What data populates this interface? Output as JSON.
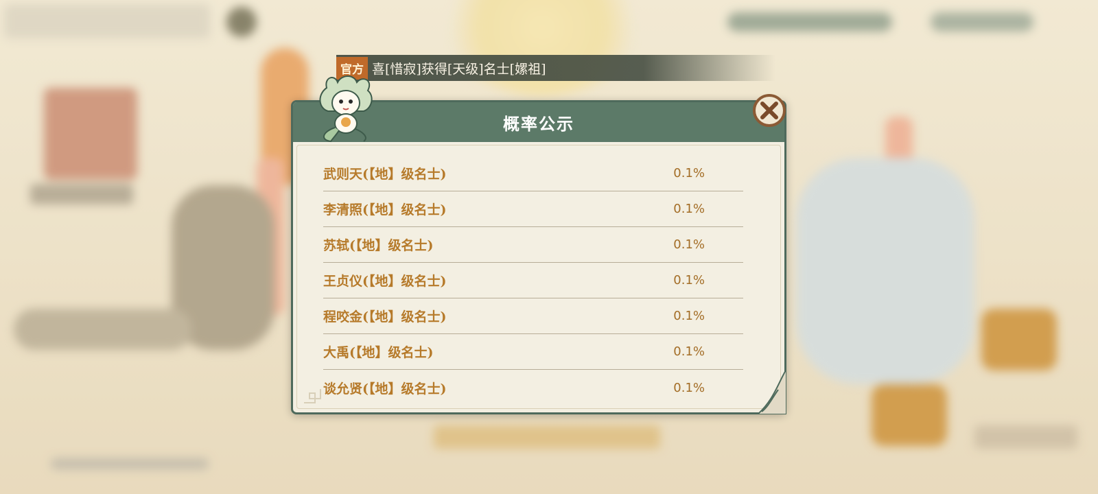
{
  "broadcast": {
    "tag": "官方",
    "message": "喜[惜寂]获得[天级]名士[嫘祖]"
  },
  "dialog": {
    "title": "概率公示",
    "close_icon": "close-x-icon",
    "rows": [
      {
        "name": "武则天(【地】级名士)",
        "rate": "0.1%"
      },
      {
        "name": "李清照(【地】级名士)",
        "rate": "0.1%"
      },
      {
        "name": "苏轼(【地】级名士)",
        "rate": "0.1%"
      },
      {
        "name": "王贞仪(【地】级名士)",
        "rate": "0.1%"
      },
      {
        "name": "程咬金(【地】级名士)",
        "rate": "0.1%"
      },
      {
        "name": "大禹(【地】级名士)",
        "rate": "0.1%"
      },
      {
        "name": "谈允贤(【地】级名士)",
        "rate": "0.1%"
      }
    ]
  },
  "colors": {
    "header": "#5c7a68",
    "border": "#4e6a5c",
    "panel": "#f3efe2",
    "item_text": "#b67a2a",
    "broadcast_tag": "#c06a2a"
  }
}
